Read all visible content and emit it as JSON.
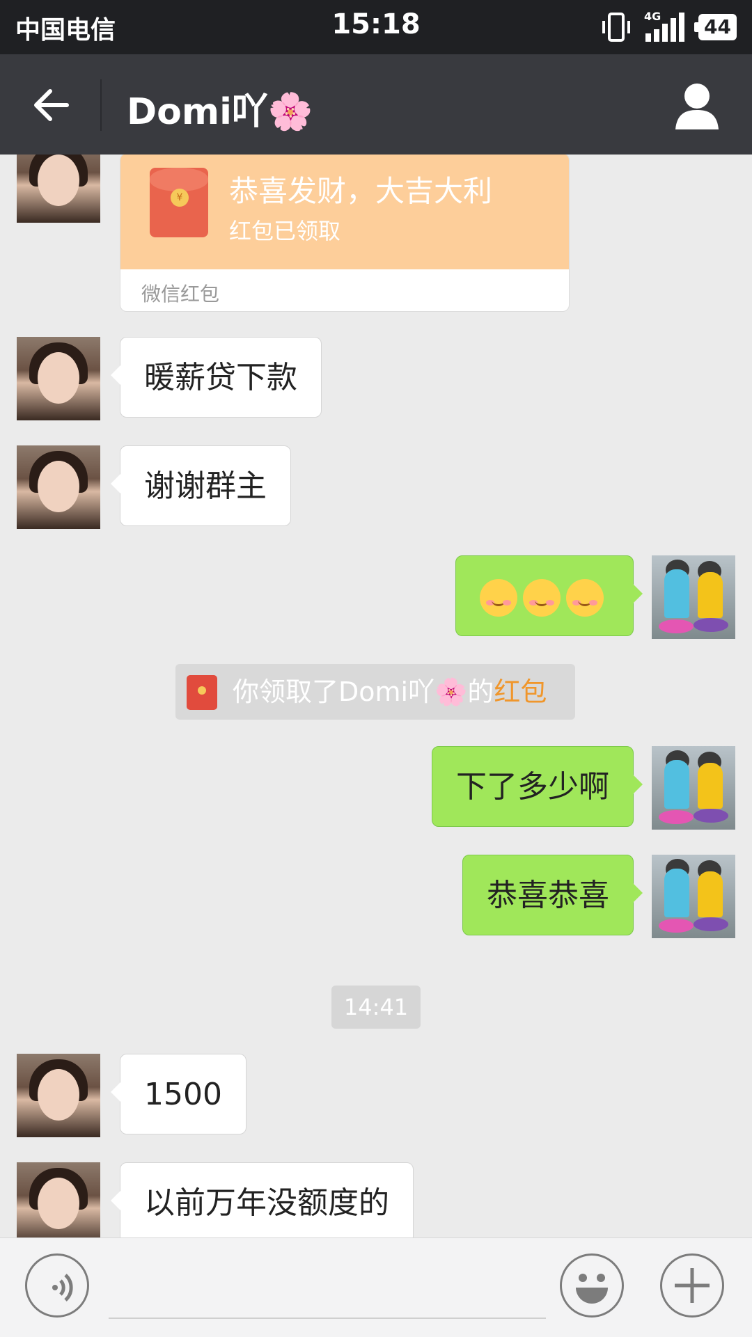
{
  "status": {
    "carrier": "中国电信",
    "time": "15:18",
    "network": "4G",
    "battery": "44"
  },
  "header": {
    "title": "Domi吖🌸"
  },
  "messages": {
    "redpacket": {
      "title": "恭喜发财，大吉大利",
      "status": "红包已领取",
      "footer": "微信红包"
    },
    "m1": "暖薪贷下款",
    "m2": "谢谢群主",
    "m4": "下了多少啊",
    "m5": "恭喜恭喜",
    "m6": "1500",
    "m7": "以前万年没额度的",
    "notice": {
      "prefix": "你领取了Domi吖🌸的",
      "link": "红包"
    },
    "time_divider": "14:41"
  },
  "colors": {
    "topbar": "#393a3f",
    "bubble_out": "#a0e75a",
    "background": "#ebebeb",
    "link": "#f0962b"
  }
}
